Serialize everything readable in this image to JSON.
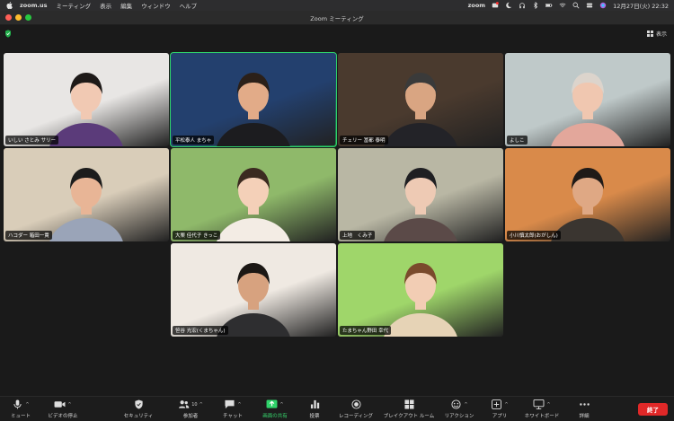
{
  "menubar": {
    "app_name": "zoom.us",
    "items": [
      "ミーティング",
      "表示",
      "編集",
      "ウィンドウ",
      "ヘルプ"
    ],
    "status_app": "zoom",
    "clock": "12月27日(火)  22:32"
  },
  "window": {
    "title": "Zoom ミーティング"
  },
  "view": {
    "label": "表示"
  },
  "participants": [
    {
      "name": "いしい さとみ サリー",
      "bg": "#e8e6e4",
      "shirt": "#5b3b7a",
      "hair": "#1e1a18",
      "skin": "#f1c9b3",
      "speaking": false
    },
    {
      "name": "平松泰人 まちゃ",
      "bg": "#23406e",
      "shirt": "#1c1c1f",
      "hair": "#2b2019",
      "skin": "#e2ab88",
      "speaking": true
    },
    {
      "name": "チェリー 冨都 泰明",
      "bg": "#4a3a2e",
      "shirt": "#232328",
      "hair": "#3a3a3a",
      "skin": "#d9a582",
      "speaking": false
    },
    {
      "name": "よしこ",
      "bg": "#bfc9c9",
      "shirt": "#e3a79b",
      "hair": "#dcd4cc",
      "skin": "#f0c7b0",
      "speaking": false
    },
    {
      "name": "ハコダー 箱田一貴",
      "bg": "#d9cdb9",
      "shirt": "#9aa4b8",
      "hair": "#1c1c1c",
      "skin": "#e8b596",
      "speaking": false
    },
    {
      "name": "大栗 佳代子 きっこ",
      "bg": "#8fb96a",
      "shirt": "#f3ece4",
      "hair": "#3b2a20",
      "skin": "#f4d0b8",
      "speaking": false
    },
    {
      "name": "上地　くみ子",
      "bg": "#b9b7a4",
      "shirt": "#5b4a48",
      "hair": "#1f1f22",
      "skin": "#eecab4",
      "speaking": false
    },
    {
      "name": "小川慎太郎(おがしん)",
      "bg": "#d98a4a",
      "shirt": "#3a3530",
      "hair": "#1f1a17",
      "skin": "#dfa884",
      "speaking": false
    },
    {
      "name": "笹谷 光宏(くまちゃん)",
      "bg": "#efe9e2",
      "shirt": "#2e2e30",
      "hair": "#1b1714",
      "skin": "#d7a27f",
      "speaking": false
    },
    {
      "name": "たまちゃん野田 幸代",
      "bg": "#9fd66a",
      "shirt": "#e6d3b6",
      "hair": "#7a4a2c",
      "skin": "#f2cdb4",
      "speaking": false
    }
  ],
  "toolbar": {
    "items": [
      {
        "label": "ミュート",
        "icon": "microphone-icon"
      },
      {
        "label": "ビデオの停止",
        "icon": "video-camera-icon"
      },
      {
        "label": "セキュリティ",
        "icon": "shield-icon"
      },
      {
        "label": "参加者",
        "icon": "participants-icon",
        "count": "10"
      },
      {
        "label": "チャット",
        "icon": "chat-bubble-icon"
      },
      {
        "label": "画面の共有",
        "icon": "share-screen-icon"
      },
      {
        "label": "投票",
        "icon": "bar-chart-icon"
      },
      {
        "label": "レコーディング",
        "icon": "record-icon"
      },
      {
        "label": "ブレイクアウト ルーム",
        "icon": "breakout-rooms-icon"
      },
      {
        "label": "リアクション",
        "icon": "reaction-icon"
      },
      {
        "label": "アプリ",
        "icon": "apps-icon"
      },
      {
        "label": "ホワイトボード",
        "icon": "whiteboard-icon"
      },
      {
        "label": "詳細",
        "icon": "more-icon"
      }
    ],
    "end_label": "終了"
  },
  "colors": {
    "accent_green": "#2fd36a",
    "end_red": "#e02828",
    "menubar_bg": "#2d2d2f",
    "stage_bg": "#1a1a1a"
  }
}
